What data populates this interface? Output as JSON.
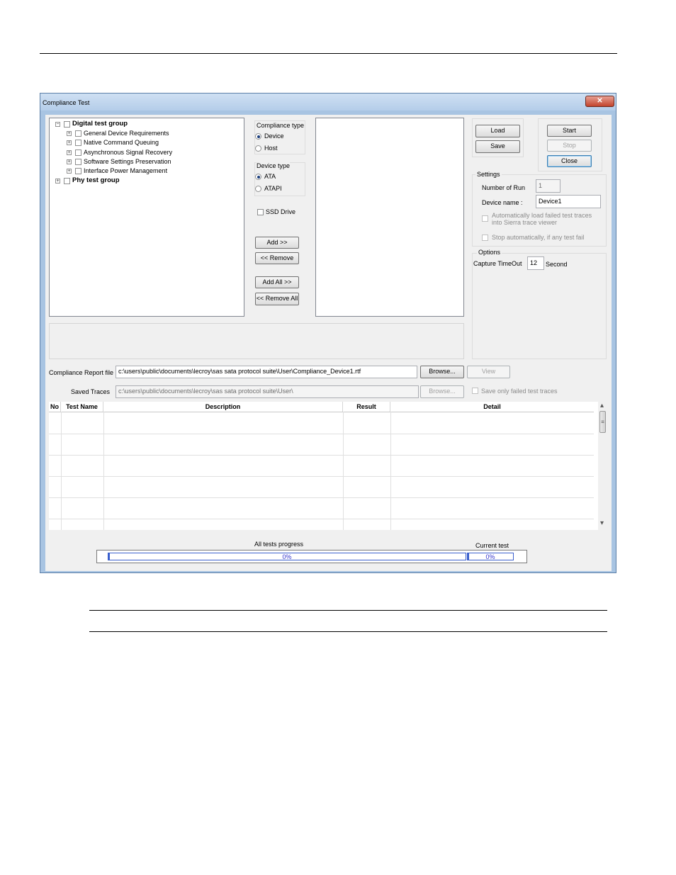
{
  "window": {
    "title": "Compliance Test",
    "close_glyph": "✕"
  },
  "tree": {
    "groups": [
      {
        "label": "Digital test group",
        "expander": "−",
        "children": [
          "General Device Requirements",
          "Native Command Queuing",
          "Asynchronous Signal Recovery",
          "Software Settings Preservation",
          "Interface Power Management"
        ]
      },
      {
        "label": "Phy test group",
        "expander": "+"
      }
    ],
    "child_expander": "+"
  },
  "compliance_type": {
    "title": "Compliance type",
    "options": [
      "Device",
      "Host"
    ],
    "selected": "Device"
  },
  "device_type": {
    "title": "Device type",
    "options": [
      "ATA",
      "ATAPI"
    ],
    "selected": "ATA"
  },
  "ssd_drive": {
    "label": "SSD Drive",
    "checked": false
  },
  "buttons": {
    "add": "Add >>",
    "remove": "<< Remove",
    "add_all": "Add All >>",
    "remove_all": "<< Remove All",
    "load": "Load",
    "save": "Save",
    "start": "Start",
    "stop": "Stop",
    "close": "Close",
    "browse_report": "Browse...",
    "view": "View",
    "browse_traces": "Browse..."
  },
  "settings": {
    "title": "Settings",
    "number_of_run_label": "Number of Run",
    "number_of_run_value": "1",
    "device_name_label": "Device name :",
    "device_name_value": "Device1",
    "auto_load_line1": "Automatically load failed test traces",
    "auto_load_line2": "into Sierra trace viewer",
    "stop_auto": "Stop automatically, if any test fail"
  },
  "options": {
    "title": "Options",
    "capture_label": "Capture TimeOut",
    "capture_value": "12",
    "unit": "Second"
  },
  "report": {
    "label": "Compliance Report file",
    "value": "c:\\users\\public\\documents\\lecroy\\sas sata protocol suite\\User\\Compliance_Device1.rtf"
  },
  "traces": {
    "label": "Saved Traces",
    "value": "c:\\users\\public\\documents\\lecroy\\sas sata protocol suite\\User\\",
    "save_failed_only": "Save only failed test traces"
  },
  "table": {
    "columns": [
      "No",
      "Test Name",
      "Description",
      "Result",
      "Detail"
    ],
    "rows": 6
  },
  "scrollbar": {
    "up": "▴",
    "down": "▾",
    "grip": "≡"
  },
  "progress": {
    "all_label": "All tests progress",
    "all_value": "0%",
    "all_fraction": 0,
    "current_label": "Current test",
    "current_value": "0%",
    "current_fraction": 0
  }
}
